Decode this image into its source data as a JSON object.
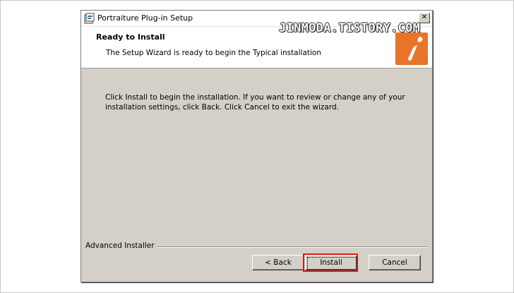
{
  "window": {
    "title": "Portraiture Plug-in Setup",
    "close_glyph": "✕"
  },
  "header": {
    "title": "Ready to Install",
    "subtitle": "The Setup Wizard is ready to begin the Typical installation"
  },
  "watermark": "JINMODA.TISTORY.COM",
  "body": {
    "line1": "Click Install to begin the installation.  If you want to review or change any of your",
    "line2": "installation settings, click Back.  Click Cancel to exit the wizard."
  },
  "footer": {
    "label": "Advanced Installer"
  },
  "buttons": {
    "back": "< Back",
    "install": "Install",
    "cancel": "Cancel"
  },
  "icons": {
    "app": "setup-package-icon",
    "logo": "imagenomic-logo",
    "close": "close-icon"
  },
  "colors": {
    "dialog_bg": "#d4d0c8",
    "logo_orange": "#e8742a",
    "highlight_red": "#d21c1c"
  }
}
